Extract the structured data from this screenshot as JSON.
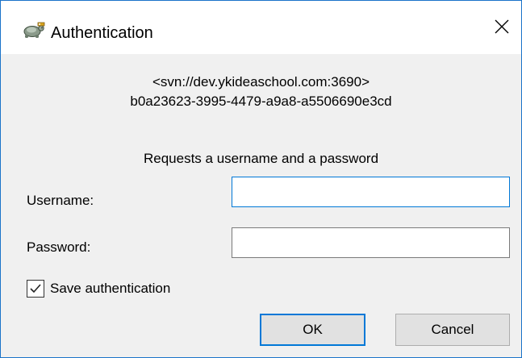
{
  "window": {
    "title": "Authentication",
    "app_icon": "tortoisesvn-icon",
    "close_glyph": "✕"
  },
  "server": {
    "url": "<svn://dev.ykideaschool.com:3690>",
    "uuid": "b0a23623-3995-4479-a9a8-a5506690e3cd"
  },
  "prompt": "Requests a username and a password",
  "form": {
    "username_label": "Username:",
    "username_value": "",
    "password_label": "Password:",
    "password_value": "",
    "save_label": "Save authentication",
    "save_checked": true
  },
  "buttons": {
    "ok": "OK",
    "cancel": "Cancel"
  },
  "colors": {
    "accent": "#0078d7",
    "dialog_bg": "#f0f0f0",
    "button_bg": "#e1e1e1"
  }
}
